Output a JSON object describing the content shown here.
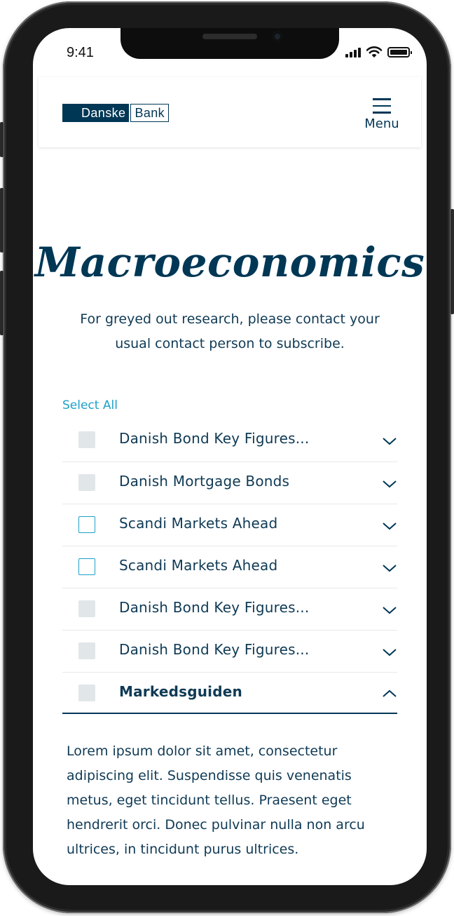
{
  "status_bar": {
    "time": "9:41",
    "icons": [
      "signal-icon",
      "wifi-icon",
      "battery-icon"
    ]
  },
  "header": {
    "logo": {
      "part1": "Danske",
      "part2": "Bank"
    },
    "menu_label": "Menu"
  },
  "page": {
    "title": "Macroeconomics",
    "subtitle": "For greyed out research, please contact your usual contact person to subscribe.",
    "select_all": "Select All"
  },
  "list": {
    "items": [
      {
        "label": "Danish Bond Key Figures...",
        "checkbox": "disabled",
        "expanded": false
      },
      {
        "label": "Danish Mortgage Bonds",
        "checkbox": "disabled",
        "expanded": false
      },
      {
        "label": "Scandi Markets Ahead",
        "checkbox": "active",
        "expanded": false
      },
      {
        "label": "Scandi Markets Ahead",
        "checkbox": "active",
        "expanded": false
      },
      {
        "label": "Danish Bond Key Figures...",
        "checkbox": "disabled",
        "expanded": false
      },
      {
        "label": "Danish Bond Key Figures...",
        "checkbox": "disabled",
        "expanded": false
      },
      {
        "label": "Markedsguiden",
        "checkbox": "disabled",
        "expanded": true
      }
    ],
    "expanded_text": "Lorem ipsum dolor sit amet, consectetur adipiscing elit. Suspendisse quis venenatis metus, eget tincidunt tellus. Praesent eget hendrerit orci. Donec pulvinar nulla non arcu ultrices, in tincidunt purus ultrices."
  },
  "colors": {
    "brand": "#003755",
    "accent": "#1ea0c8",
    "text": "#0f3a55",
    "disabled_checkbox": "#e1e6e9"
  }
}
